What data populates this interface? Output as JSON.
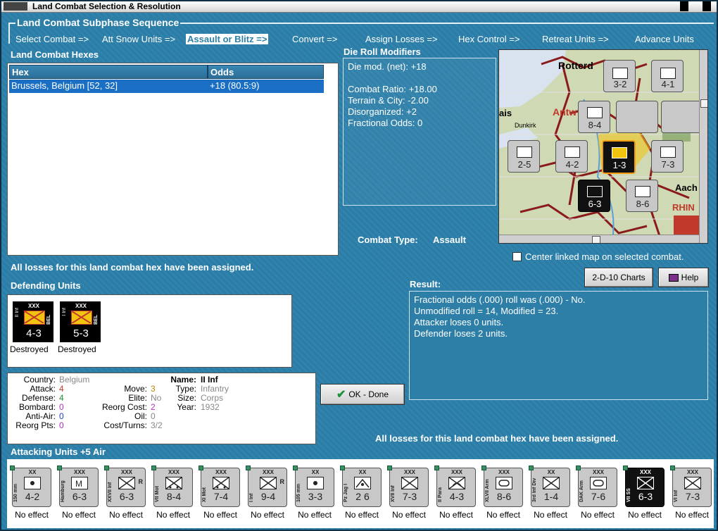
{
  "window": {
    "title": "Land Combat Selection & Resolution"
  },
  "sequence": {
    "title": "Land Combat Subphase Sequence",
    "steps": [
      {
        "label": "Select Combat =>"
      },
      {
        "label": "Att Snow Units =>"
      },
      {
        "label": "Assault or Blitz =>"
      },
      {
        "label": "Convert =>"
      },
      {
        "label": "Assign Losses =>"
      },
      {
        "label": "Hex Control =>"
      },
      {
        "label": "Retreat Units =>"
      },
      {
        "label": "Advance Units"
      }
    ]
  },
  "hexes": {
    "title": "Land Combat Hexes",
    "col_hex": "Hex",
    "col_odds": "Odds",
    "row": {
      "hex": "Brussels, Belgium [52, 32]",
      "odds": "+18 (80.5:9)"
    }
  },
  "drm": {
    "title": "Die Roll Modifiers",
    "lines": [
      "Die mod. (net): +18",
      "Combat Ratio: +18.00",
      "Terrain & City: -2.00",
      "Disorganized: +2",
      "Fractional Odds: 0"
    ]
  },
  "combat_type": {
    "label": "Combat Type:",
    "value": "Assault"
  },
  "map": {
    "labels": [
      "Rotterd",
      "Antw",
      "ais",
      "Dunkirk",
      "Aach",
      "RHIN",
      "Dy",
      "Emi",
      "Emi"
    ]
  },
  "center_map": {
    "label": "Center linked map on selected combat."
  },
  "losses_msg": "All losses for this land combat hex have been assigned.",
  "buttons": {
    "charts": "2-D-10 Charts",
    "help": "Help",
    "ok": "OK - Done"
  },
  "result": {
    "title": "Result:",
    "lines": [
      "Fractional odds (.000) roll was (.000)  - No.",
      "Unmodified roll = 14, Modified = 23.",
      "Attacker loses 0 units.",
      "Defender loses 2 units."
    ]
  },
  "defending": {
    "title": "Defending Units",
    "units": [
      {
        "name": "II Inf",
        "size": "XXX",
        "nat": "BEL",
        "str": "4-3",
        "status": "Destroyed"
      },
      {
        "name": "I Inf",
        "size": "XXX",
        "nat": "BEL",
        "str": "5-3",
        "status": "Destroyed"
      }
    ]
  },
  "details": {
    "country_k": "Country:",
    "country_v": "Belgium",
    "attack_k": "Attack:",
    "attack_v": "4",
    "defense_k": "Defense:",
    "defense_v": "4",
    "bombard_k": "Bombard:",
    "bombard_v": "0",
    "antiair_k": "Anti-Air:",
    "antiair_v": "0",
    "reorgpts_k": "Reorg Pts:",
    "reorgpts_v": "0",
    "move_k": "Move:",
    "move_v": "3",
    "elite_k": "Elite:",
    "elite_v": "No",
    "reorgcost_k": "Reorg Cost:",
    "reorgcost_v": "2",
    "oil_k": "Oil:",
    "oil_v": "0",
    "costturns_k": "Cost/Turns:",
    "costturns_v": "3/2",
    "name_k": "Name:",
    "name_v": "II Inf",
    "type_k": "Type:",
    "type_v": "Infantry",
    "size_k": "Size:",
    "size_v": "Corps",
    "year_k": "Year:",
    "year_v": "1932"
  },
  "bottom_msg": "All losses for this land combat hex have been assigned.",
  "attacking": {
    "title": "Attacking Units +5 Air",
    "units": [
      {
        "name": "150 mm",
        "size": "XX",
        "str": "4-2",
        "sym": "art",
        "label": "No effect"
      },
      {
        "name": "Hamburg",
        "size": "XXX",
        "str": "6-3",
        "sym": "mtn",
        "label": "No effect"
      },
      {
        "name": "XXVII Inf",
        "size": "XXX",
        "str": "6-3",
        "sym": "inf",
        "r": "R",
        "label": "No effect"
      },
      {
        "name": "VII Mot",
        "size": "XXX",
        "str": "8-4",
        "sym": "mot",
        "label": "No effect"
      },
      {
        "name": "XI Mot",
        "size": "XXX",
        "str": "7-4",
        "sym": "mot",
        "label": "No effect"
      },
      {
        "name": "I Inf",
        "size": "XXX",
        "str": "9-4",
        "sym": "inf",
        "r": "R",
        "label": "No effect"
      },
      {
        "name": "105 mm",
        "size": "XX",
        "str": "3-3",
        "sym": "art",
        "label": "No effect"
      },
      {
        "name": "Pz Jag I",
        "size": "XX",
        "str": "2 6",
        "sym": "at",
        "label": "No effect"
      },
      {
        "name": "XVII Inf",
        "size": "XXX",
        "str": "7-3",
        "sym": "inf",
        "label": "No effect"
      },
      {
        "name": "II Para",
        "size": "XXX",
        "str": "4-3",
        "sym": "para",
        "label": "No effect"
      },
      {
        "name": "XLVII Arm",
        "size": "XXX",
        "str": "8-6",
        "sym": "arm",
        "label": "No effect"
      },
      {
        "name": "3rd Inf Div",
        "size": "XX",
        "str": "1-4",
        "sym": "inf",
        "label": "No effect"
      },
      {
        "name": "DAK Arm",
        "size": "XXX",
        "str": "7-6",
        "sym": "arm",
        "label": "No effect"
      },
      {
        "name": "VII SS",
        "size": "XXX",
        "str": "6-3",
        "sym": "inf",
        "black": true,
        "label": "No effect"
      },
      {
        "name": "VI Inf",
        "size": "XXX",
        "str": "7-3",
        "sym": "inf",
        "label": "No effect"
      }
    ]
  }
}
